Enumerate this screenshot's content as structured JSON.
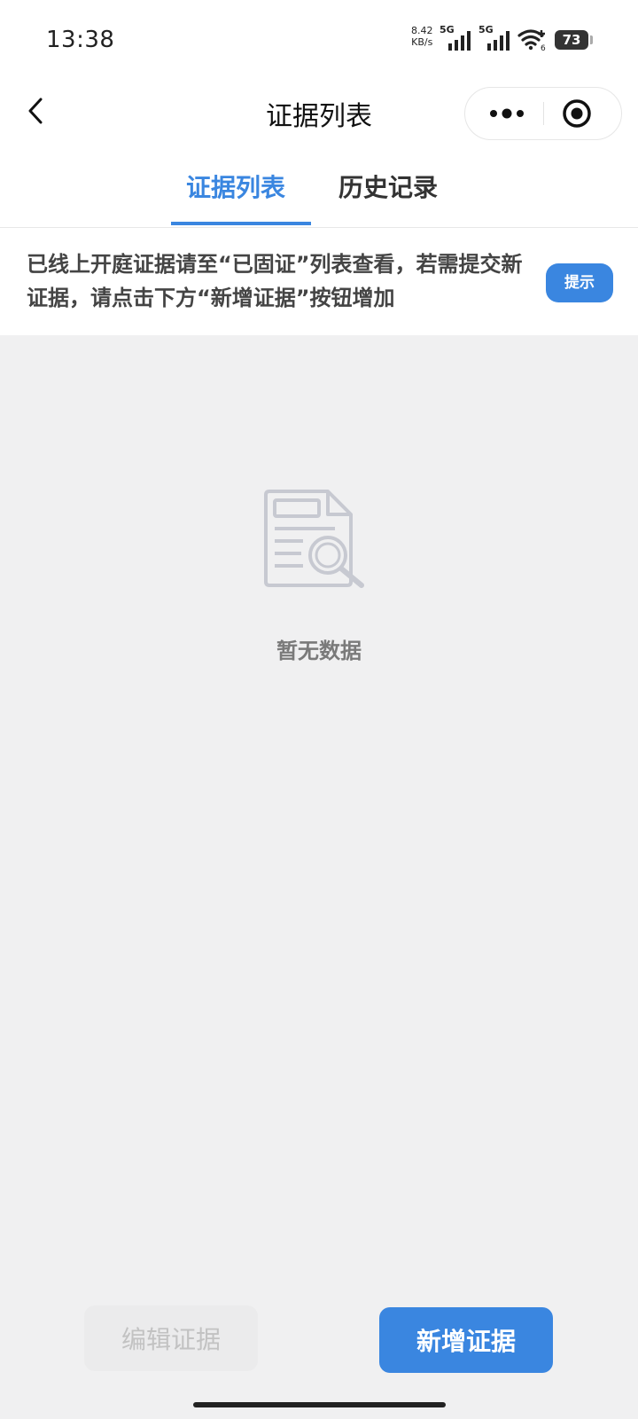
{
  "status_bar": {
    "time": "13:38",
    "net_speed_value": "8.42",
    "net_speed_unit": "KB/s",
    "sim1_label": "5G",
    "sim2_label": "5G",
    "wifi_sub": "6",
    "battery": "73"
  },
  "nav": {
    "title": "证据列表",
    "back_icon": "chevron-left-icon",
    "more_icon": "more-dots-icon",
    "close_icon": "target-close-icon"
  },
  "tabs": [
    {
      "label": "证据列表",
      "active": true
    },
    {
      "label": "历史记录",
      "active": false
    }
  ],
  "notice": {
    "text": "已线上开庭证据请至“已固证”列表查看，若需提交新证据，请点击下方“新增证据”按钮增加",
    "hint_button": "提示"
  },
  "empty_state": {
    "icon": "document-search-icon",
    "text": "暂无数据"
  },
  "bottom_actions": {
    "edit_label": "编辑证据",
    "add_label": "新增证据"
  },
  "colors": {
    "accent": "#3a86e0",
    "background": "#f0f0f1",
    "empty_icon": "#c7c9d1"
  }
}
